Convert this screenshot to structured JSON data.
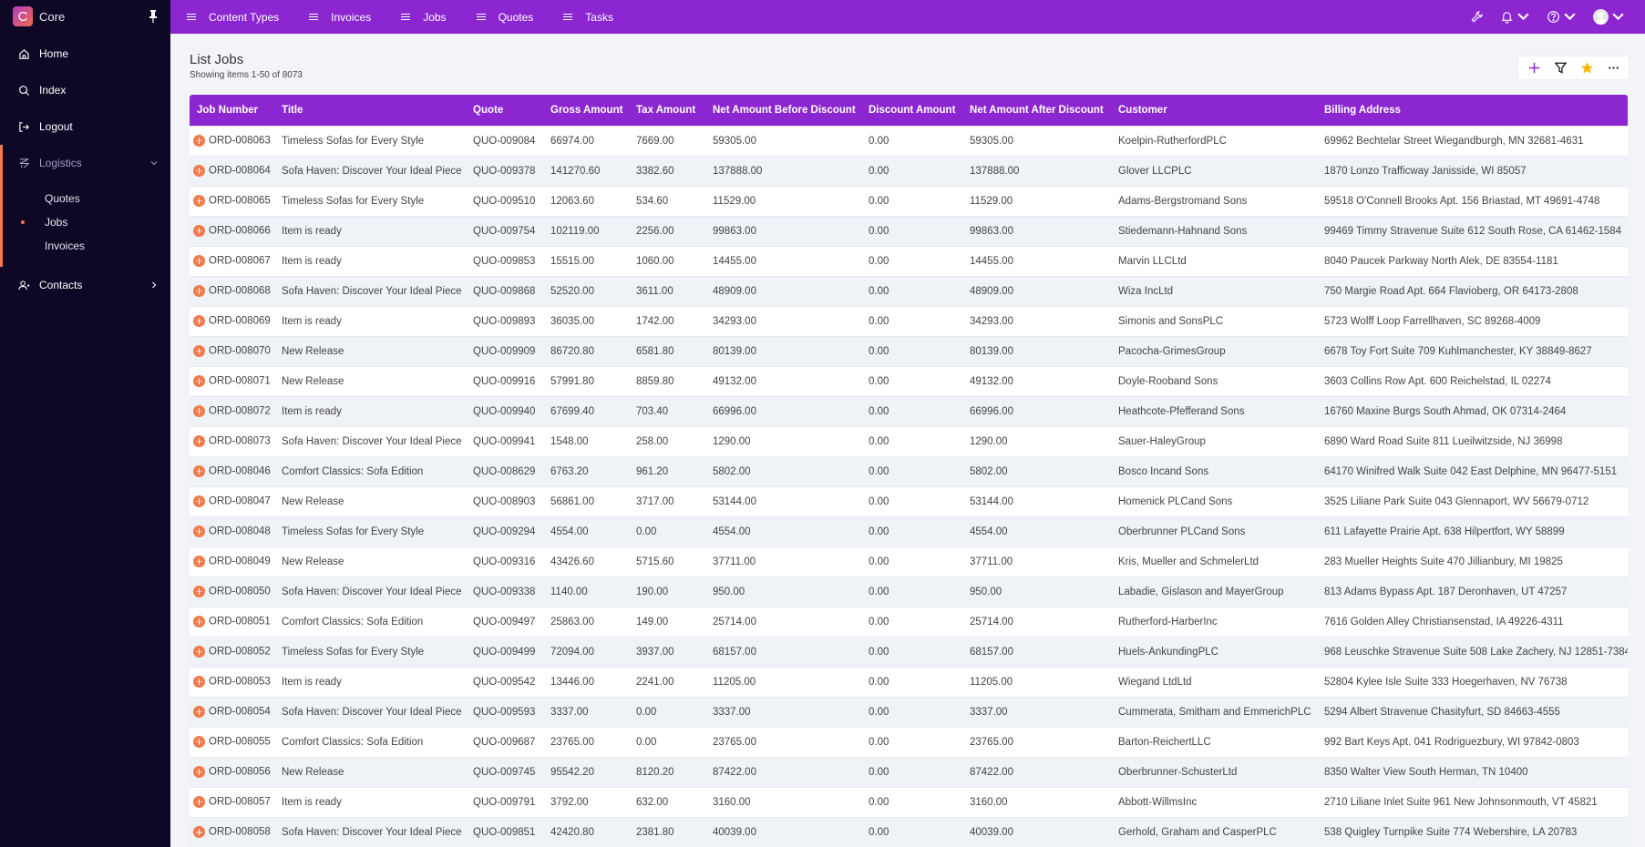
{
  "sidebar": {
    "brand_letter": "C",
    "brand_name": "Core",
    "items": [
      {
        "label": "Home",
        "icon": "home-icon"
      },
      {
        "label": "Index",
        "icon": "search-icon"
      },
      {
        "label": "Logout",
        "icon": "logout-icon"
      }
    ],
    "group": {
      "label": "Logistics",
      "icon": "logistics-icon",
      "expanded": true,
      "children": [
        {
          "label": "Quotes",
          "active": false
        },
        {
          "label": "Jobs",
          "active": true
        },
        {
          "label": "Invoices",
          "active": false
        }
      ]
    },
    "contacts": {
      "label": "Contacts",
      "icon": "contacts-icon"
    }
  },
  "topbar": {
    "tabs": [
      {
        "label": "Content Types"
      },
      {
        "label": "Invoices"
      },
      {
        "label": "Jobs"
      },
      {
        "label": "Quotes"
      },
      {
        "label": "Tasks"
      }
    ],
    "right_icons": [
      "wrench-icon",
      "bell-icon",
      "help-icon",
      "user-avatar"
    ]
  },
  "page": {
    "title": "List Jobs",
    "subtitle": "Showing items 1-50 of 8073",
    "actions": [
      "add-icon",
      "filter-icon",
      "star-icon",
      "more-icon"
    ]
  },
  "colors": {
    "accent": "#8b26d1",
    "sidebar_bg": "#0e0726",
    "row_icon": "#f37a4a",
    "star": "#f5b800"
  },
  "table": {
    "columns": [
      "Job Number",
      "Title",
      "Quote",
      "Gross Amount",
      "Tax Amount",
      "Net Amount Before Discount",
      "Discount Amount",
      "Net Amount After Discount",
      "Customer",
      "Billing Address"
    ],
    "rows": [
      [
        "ORD-008063",
        "Timeless Sofas for Every Style",
        "QUO-009084",
        "66974.00",
        "7669.00",
        "59305.00",
        "0.00",
        "59305.00",
        "Koelpin-RutherfordPLC",
        "69962 Bechtelar Street Wiegandburgh, MN 32681-4631"
      ],
      [
        "ORD-008064",
        "Sofa Haven: Discover Your Ideal Piece",
        "QUO-009378",
        "141270.60",
        "3382.60",
        "137888.00",
        "0.00",
        "137888.00",
        "Glover LLCPLC",
        "1870 Lonzo Trafficway Janisside, WI 85057"
      ],
      [
        "ORD-008065",
        "Timeless Sofas for Every Style",
        "QUO-009510",
        "12063.60",
        "534.60",
        "11529.00",
        "0.00",
        "11529.00",
        "Adams-Bergstromand Sons",
        "59518 O'Connell Brooks Apt. 156 Briastad, MT 49691-4748"
      ],
      [
        "ORD-008066",
        "Item is ready",
        "QUO-009754",
        "102119.00",
        "2256.00",
        "99863.00",
        "0.00",
        "99863.00",
        "Stiedemann-Hahnand Sons",
        "99469 Timmy Stravenue Suite 612 South Rose, CA 61462-1584"
      ],
      [
        "ORD-008067",
        "Item is ready",
        "QUO-009853",
        "15515.00",
        "1060.00",
        "14455.00",
        "0.00",
        "14455.00",
        "Marvin LLCLtd",
        "8040 Paucek Parkway North Alek, DE 83554-1181"
      ],
      [
        "ORD-008068",
        "Sofa Haven: Discover Your Ideal Piece",
        "QUO-009868",
        "52520.00",
        "3611.00",
        "48909.00",
        "0.00",
        "48909.00",
        "Wiza IncLtd",
        "750 Margie Road Apt. 664 Flavioberg, OR 64173-2808"
      ],
      [
        "ORD-008069",
        "Item is ready",
        "QUO-009893",
        "36035.00",
        "1742.00",
        "34293.00",
        "0.00",
        "34293.00",
        "Simonis and SonsPLC",
        "5723 Wolff Loop Farrellhaven, SC 89268-4009"
      ],
      [
        "ORD-008070",
        "New Release",
        "QUO-009909",
        "86720.80",
        "6581.80",
        "80139.00",
        "0.00",
        "80139.00",
        "Pacocha-GrimesGroup",
        "6678 Toy Fort Suite 709 Kuhlmanchester, KY 38849-8627"
      ],
      [
        "ORD-008071",
        "New Release",
        "QUO-009916",
        "57991.80",
        "8859.80",
        "49132.00",
        "0.00",
        "49132.00",
        "Doyle-Rooband Sons",
        "3603 Collins Row Apt. 600 Reichelstad, IL 02274"
      ],
      [
        "ORD-008072",
        "Item is ready",
        "QUO-009940",
        "67699.40",
        "703.40",
        "66996.00",
        "0.00",
        "66996.00",
        "Heathcote-Pfefferand Sons",
        "16760 Maxine Burgs South Ahmad, OK 07314-2464"
      ],
      [
        "ORD-008073",
        "Sofa Haven: Discover Your Ideal Piece",
        "QUO-009941",
        "1548.00",
        "258.00",
        "1290.00",
        "0.00",
        "1290.00",
        "Sauer-HaleyGroup",
        "6890 Ward Road Suite 811 Lueilwitzside, NJ 36998"
      ],
      [
        "ORD-008046",
        "Comfort Classics: Sofa Edition",
        "QUO-008629",
        "6763.20",
        "961.20",
        "5802.00",
        "0.00",
        "5802.00",
        "Bosco Incand Sons",
        "64170 Winifred Walk Suite 042 East Delphine, MN 96477-5151"
      ],
      [
        "ORD-008047",
        "New Release",
        "QUO-008903",
        "56861.00",
        "3717.00",
        "53144.00",
        "0.00",
        "53144.00",
        "Homenick PLCand Sons",
        "3525 Liliane Park Suite 043 Glennaport, WV 56679-0712"
      ],
      [
        "ORD-008048",
        "Timeless Sofas for Every Style",
        "QUO-009294",
        "4554.00",
        "0.00",
        "4554.00",
        "0.00",
        "4554.00",
        "Oberbrunner PLCand Sons",
        "611 Lafayette Prairie Apt. 638 Hilpertfort, WY 58899"
      ],
      [
        "ORD-008049",
        "New Release",
        "QUO-009316",
        "43426.60",
        "5715.60",
        "37711.00",
        "0.00",
        "37711.00",
        "Kris, Mueller and SchmelerLtd",
        "283 Mueller Heights Suite 470 Jillianbury, MI 19825"
      ],
      [
        "ORD-008050",
        "Sofa Haven: Discover Your Ideal Piece",
        "QUO-009338",
        "1140.00",
        "190.00",
        "950.00",
        "0.00",
        "950.00",
        "Labadie, Gislason and MayerGroup",
        "813 Adams Bypass Apt. 187 Deronhaven, UT 47257"
      ],
      [
        "ORD-008051",
        "Comfort Classics: Sofa Edition",
        "QUO-009497",
        "25863.00",
        "149.00",
        "25714.00",
        "0.00",
        "25714.00",
        "Rutherford-HarberInc",
        "7616 Golden Alley Christiansenstad, IA 49226-4311"
      ],
      [
        "ORD-008052",
        "Timeless Sofas for Every Style",
        "QUO-009499",
        "72094.00",
        "3937.00",
        "68157.00",
        "0.00",
        "68157.00",
        "Huels-AnkundingPLC",
        "968 Leuschke Stravenue Suite 508 Lake Zachery, NJ 12851-7384"
      ],
      [
        "ORD-008053",
        "Item is ready",
        "QUO-009542",
        "13446.00",
        "2241.00",
        "11205.00",
        "0.00",
        "11205.00",
        "Wiegand LtdLtd",
        "52804 Kylee Isle Suite 333 Hoegerhaven, NV 76738"
      ],
      [
        "ORD-008054",
        "Sofa Haven: Discover Your Ideal Piece",
        "QUO-009593",
        "3337.00",
        "0.00",
        "3337.00",
        "0.00",
        "3337.00",
        "Cummerata, Smitham and EmmerichPLC",
        "5294 Albert Stravenue Chasityfurt, SD 84663-4555"
      ],
      [
        "ORD-008055",
        "Comfort Classics: Sofa Edition",
        "QUO-009687",
        "23765.00",
        "0.00",
        "23765.00",
        "0.00",
        "23765.00",
        "Barton-ReichertLLC",
        "992 Bart Keys Apt. 041 Rodriguezbury, WI 97842-0803"
      ],
      [
        "ORD-008056",
        "New Release",
        "QUO-009745",
        "95542.20",
        "8120.20",
        "87422.00",
        "0.00",
        "87422.00",
        "Oberbrunner-SchusterLtd",
        "8350 Walter View South Herman, TN 10400"
      ],
      [
        "ORD-008057",
        "Item is ready",
        "QUO-009791",
        "3792.00",
        "632.00",
        "3160.00",
        "0.00",
        "3160.00",
        "Abbott-WillmsInc",
        "2710 Liliane Inlet Suite 961 New Johnsonmouth, VT 45821"
      ],
      [
        "ORD-008058",
        "Sofa Haven: Discover Your Ideal Piece",
        "QUO-009851",
        "42420.80",
        "2381.80",
        "40039.00",
        "0.00",
        "40039.00",
        "Gerhold, Graham and CasperPLC",
        "538 Quigley Turnpike Suite 774 Webershire, LA 20783"
      ]
    ]
  }
}
